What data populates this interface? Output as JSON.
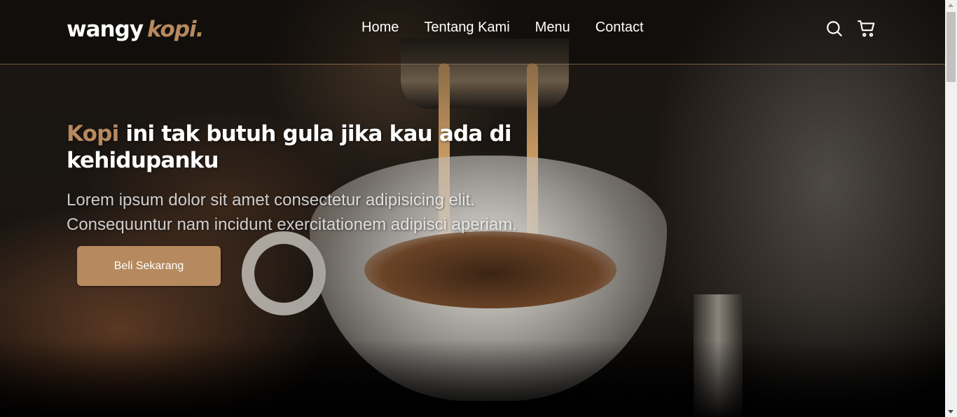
{
  "brand": {
    "name": "wangy",
    "accent": "kopi.",
    "accent_color": "#b6895e"
  },
  "nav": {
    "links": [
      {
        "label": "Home"
      },
      {
        "label": "Tentang Kami"
      },
      {
        "label": "Menu"
      },
      {
        "label": "Contact"
      }
    ],
    "icons": [
      "search-icon",
      "cart-icon"
    ]
  },
  "hero": {
    "headline_accent": "Kopi",
    "headline_rest": "ini tak butuh gula jika kau ada di kehidupanku",
    "subtext": "Lorem ipsum dolor sit amet consectetur adipisicing elit. Consequuntur nam incidunt exercitationem adipisci aperiam.",
    "cta_label": "Beli Sekarang"
  },
  "colors": {
    "primary": "#b6895e",
    "background": "#010101",
    "text": "#ffffff"
  }
}
